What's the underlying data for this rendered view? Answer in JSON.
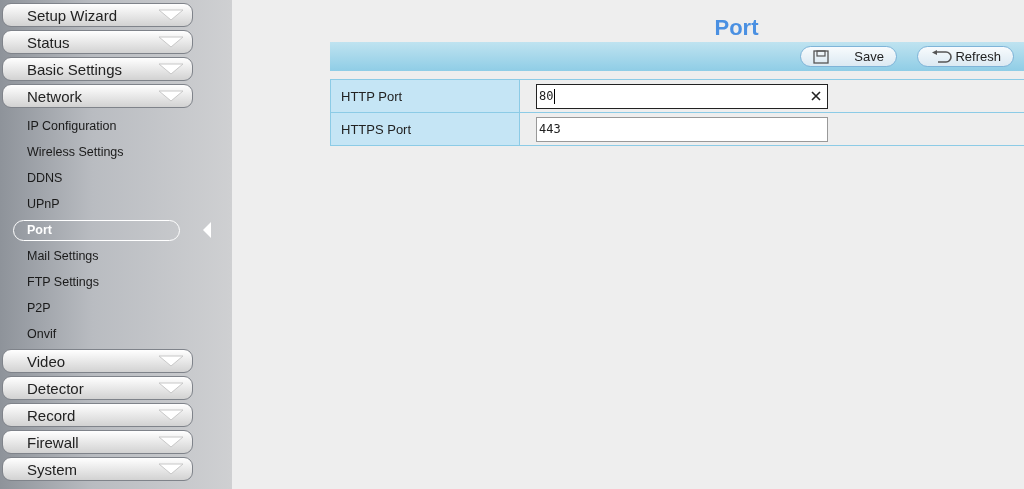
{
  "sidebar": {
    "items": [
      {
        "label": "Setup Wizard"
      },
      {
        "label": "Status"
      },
      {
        "label": "Basic Settings"
      },
      {
        "label": "Network",
        "children": [
          {
            "label": "IP Configuration",
            "selected": false
          },
          {
            "label": "Wireless Settings",
            "selected": false
          },
          {
            "label": "DDNS",
            "selected": false
          },
          {
            "label": "UPnP",
            "selected": false
          },
          {
            "label": "Port",
            "selected": true
          },
          {
            "label": "Mail Settings",
            "selected": false
          },
          {
            "label": "FTP Settings",
            "selected": false
          },
          {
            "label": "P2P",
            "selected": false
          },
          {
            "label": "Onvif",
            "selected": false
          }
        ]
      },
      {
        "label": "Video"
      },
      {
        "label": "Detector"
      },
      {
        "label": "Record"
      },
      {
        "label": "Firewall"
      },
      {
        "label": "System"
      }
    ]
  },
  "page": {
    "title": "Port",
    "toolbar": [
      {
        "kind": "save",
        "label": "Save"
      },
      {
        "kind": "refresh",
        "label": "Refresh"
      }
    ],
    "rows": [
      {
        "label": "HTTP Port",
        "value": "80",
        "focused": true
      },
      {
        "label": "HTTPS Port",
        "value": "443",
        "focused": false
      }
    ]
  }
}
